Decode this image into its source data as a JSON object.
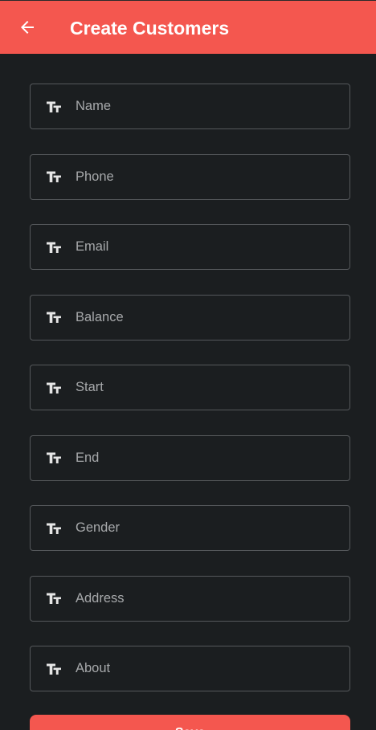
{
  "appbar": {
    "title": "Create Customers",
    "back_icon": "arrow-left-icon",
    "color": "#f4574f"
  },
  "form": {
    "field_icon": "text-fields-icon",
    "fields": [
      {
        "placeholder": "Name",
        "value": ""
      },
      {
        "placeholder": "Phone",
        "value": ""
      },
      {
        "placeholder": "Email",
        "value": ""
      },
      {
        "placeholder": "Balance",
        "value": ""
      },
      {
        "placeholder": "Start",
        "value": ""
      },
      {
        "placeholder": "End",
        "value": ""
      },
      {
        "placeholder": "Gender",
        "value": ""
      },
      {
        "placeholder": "Address",
        "value": ""
      },
      {
        "placeholder": "About",
        "value": ""
      }
    ]
  },
  "actions": {
    "save_label": "Save",
    "save_color": "#f4574f"
  },
  "theme": {
    "background": "#1b1e20",
    "border": "#55585b",
    "placeholder": "#a7a9ab"
  }
}
